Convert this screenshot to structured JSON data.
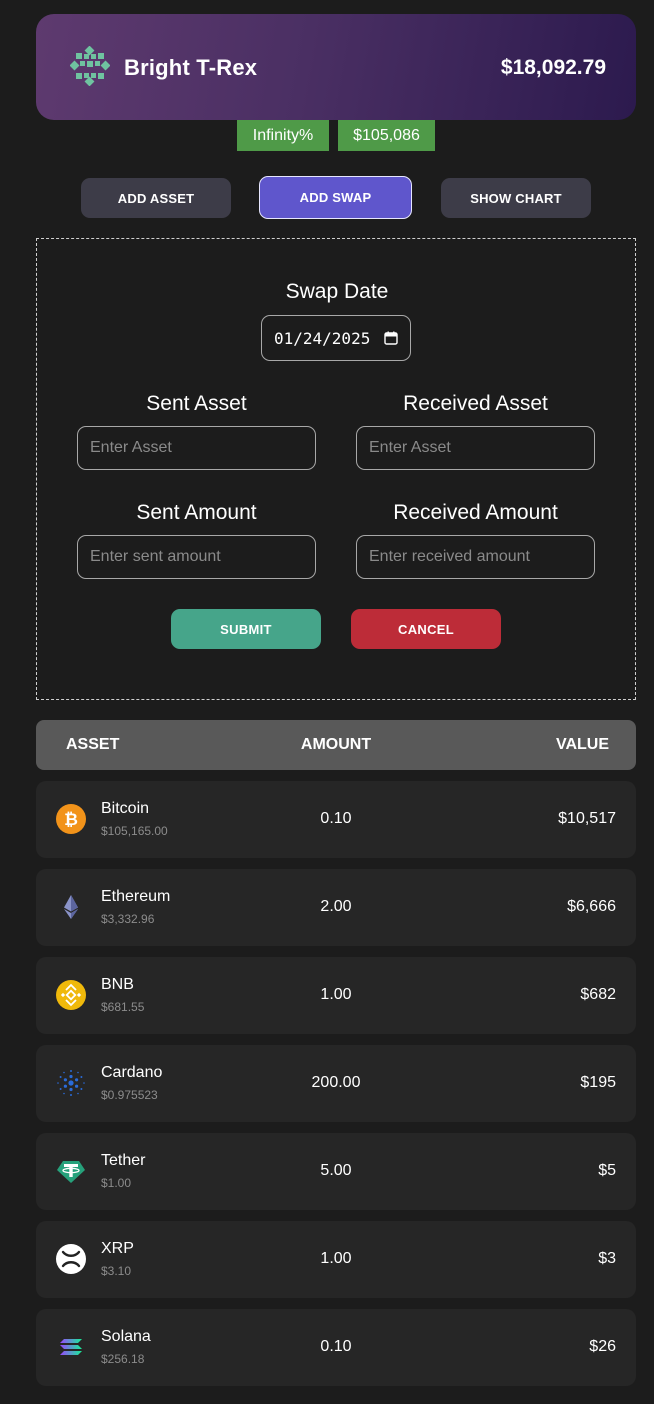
{
  "header": {
    "wallet_name": "Bright T-Rex",
    "total_value": "$18,092.79"
  },
  "badges": {
    "change_pct": "Infinity%",
    "change_value": "$105,086"
  },
  "actions": {
    "add_asset": "ADD ASSET",
    "add_swap": "ADD SWAP",
    "show_chart": "SHOW CHART"
  },
  "swap_form": {
    "date_label": "Swap Date",
    "date_value": "01/24/2025",
    "sent_asset_label": "Sent Asset",
    "received_asset_label": "Received Asset",
    "sent_asset_placeholder": "Enter Asset",
    "received_asset_placeholder": "Enter Asset",
    "sent_amount_label": "Sent Amount",
    "received_amount_label": "Received Amount",
    "sent_amount_placeholder": "Enter sent amount",
    "received_amount_placeholder": "Enter received amount",
    "submit": "SUBMIT",
    "cancel": "CANCEL"
  },
  "table": {
    "headers": {
      "asset": "ASSET",
      "amount": "AMOUNT",
      "value": "VALUE"
    },
    "rows": [
      {
        "name": "Bitcoin",
        "price": "$105,165.00",
        "amount": "0.10",
        "value": "$10,517",
        "icon": "bitcoin-icon"
      },
      {
        "name": "Ethereum",
        "price": "$3,332.96",
        "amount": "2.00",
        "value": "$6,666",
        "icon": "ethereum-icon"
      },
      {
        "name": "BNB",
        "price": "$681.55",
        "amount": "1.00",
        "value": "$682",
        "icon": "bnb-icon"
      },
      {
        "name": "Cardano",
        "price": "$0.975523",
        "amount": "200.00",
        "value": "$195",
        "icon": "cardano-icon"
      },
      {
        "name": "Tether",
        "price": "$1.00",
        "amount": "5.00",
        "value": "$5",
        "icon": "tether-icon"
      },
      {
        "name": "XRP",
        "price": "$3.10",
        "amount": "1.00",
        "value": "$3",
        "icon": "xrp-icon"
      },
      {
        "name": "Solana",
        "price": "$256.18",
        "amount": "0.10",
        "value": "$26",
        "icon": "solana-icon"
      }
    ]
  },
  "colors": {
    "accent": "#5f56cc",
    "positive": "#4f9a48",
    "submit": "#46a58a",
    "cancel": "#bd2c38"
  }
}
